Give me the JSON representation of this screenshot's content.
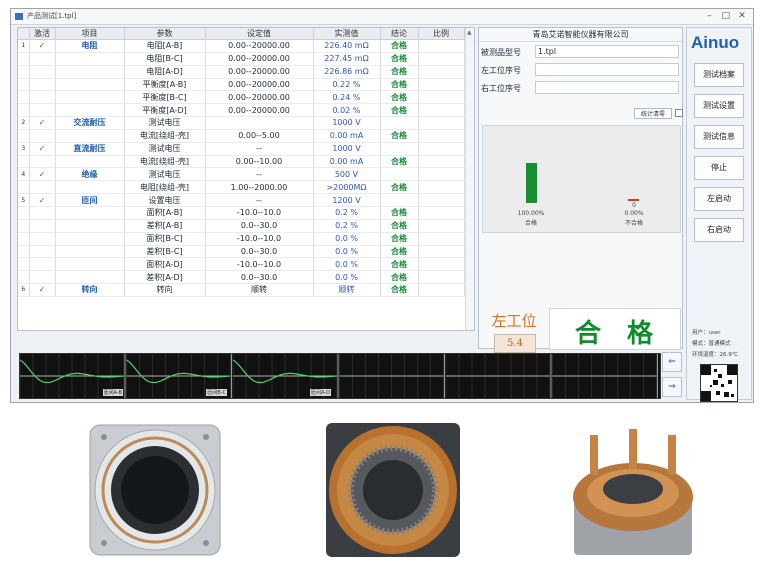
{
  "window": {
    "title": "产品测试[1.tpl]",
    "controls": [
      "–",
      "□",
      "✕"
    ]
  },
  "table": {
    "headers": [
      "",
      "激活",
      "项目",
      "参数",
      "设定值",
      "实测值",
      "结论",
      "比例"
    ],
    "rows": [
      {
        "idx": "1",
        "chk": "✓",
        "item": "电阻",
        "param": "电阻[A-B]",
        "set": "0.00--20000.00",
        "meas": "226.40 mΩ",
        "res": "合格"
      },
      {
        "idx": "",
        "chk": "",
        "item": "",
        "param": "电阻[B-C]",
        "set": "0.00--20000.00",
        "meas": "227.45 mΩ",
        "res": "合格"
      },
      {
        "idx": "",
        "chk": "",
        "item": "",
        "param": "电阻[A-D]",
        "set": "0.00--20000.00",
        "meas": "226.86 mΩ",
        "res": "合格"
      },
      {
        "idx": "",
        "chk": "",
        "item": "",
        "param": "平衡度[A-B]",
        "set": "0.00--20000.00",
        "meas": "0.22 %",
        "res": "合格"
      },
      {
        "idx": "",
        "chk": "",
        "item": "",
        "param": "平衡度[B-C]",
        "set": "0.00--20000.00",
        "meas": "0.24 %",
        "res": "合格"
      },
      {
        "idx": "",
        "chk": "",
        "item": "",
        "param": "平衡度[A-D]",
        "set": "0.00--20000.00",
        "meas": "0.02 %",
        "res": "合格"
      },
      {
        "idx": "2",
        "chk": "✓",
        "item": "交流耐压",
        "param": "测试电压",
        "set": "",
        "meas": "1000 V",
        "res": ""
      },
      {
        "idx": "",
        "chk": "",
        "item": "",
        "param": "电流[绕组-壳]",
        "set": "0.00--5.00",
        "meas": "0.00 mA",
        "res": "合格"
      },
      {
        "idx": "3",
        "chk": "✓",
        "item": "直流耐压",
        "param": "测试电压",
        "set": "--",
        "meas": "1000 V",
        "res": ""
      },
      {
        "idx": "",
        "chk": "",
        "item": "",
        "param": "电流[绕组-壳]",
        "set": "0.00--10.00",
        "meas": "0.00 mA",
        "res": "合格"
      },
      {
        "idx": "4",
        "chk": "✓",
        "item": "绝缘",
        "param": "测试电压",
        "set": "--",
        "meas": "500 V",
        "res": ""
      },
      {
        "idx": "",
        "chk": "",
        "item": "",
        "param": "电阻[绕组-壳]",
        "set": "1.00--2000.00",
        "meas": ">2000MΩ",
        "res": "合格"
      },
      {
        "idx": "5",
        "chk": "✓",
        "item": "匝间",
        "param": "设置电压",
        "set": "--",
        "meas": "1200 V",
        "res": ""
      },
      {
        "idx": "",
        "chk": "",
        "item": "",
        "param": "面积[A-B]",
        "set": "-10.0--10.0",
        "meas": "0.2 %",
        "res": "合格"
      },
      {
        "idx": "",
        "chk": "",
        "item": "",
        "param": "差积[A-B]",
        "set": "0.0--30.0",
        "meas": "0.2 %",
        "res": "合格"
      },
      {
        "idx": "",
        "chk": "",
        "item": "",
        "param": "面积[B-C]",
        "set": "-10.0--10.0",
        "meas": "0.0 %",
        "res": "合格"
      },
      {
        "idx": "",
        "chk": "",
        "item": "",
        "param": "差积[B-C]",
        "set": "0.0--30.0",
        "meas": "0.0 %",
        "res": "合格"
      },
      {
        "idx": "",
        "chk": "",
        "item": "",
        "param": "面积[A-D]",
        "set": "-10.0--10.0",
        "meas": "0.0 %",
        "res": "合格"
      },
      {
        "idx": "",
        "chk": "",
        "item": "",
        "param": "差积[A-D]",
        "set": "0.0--30.0",
        "meas": "0.0 %",
        "res": "合格"
      },
      {
        "idx": "6",
        "chk": "✓",
        "item": "转向",
        "param": "转向",
        "set": "顺转",
        "meas": "顺转",
        "res": "合格"
      }
    ]
  },
  "info": {
    "company": "青岛艾诺智能仪器有限公司",
    "model_label": "被测品型号",
    "model_value": "1.tpl",
    "left_serial_label": "左工位序号",
    "left_serial_value": "",
    "right_serial_label": "右工位序号",
    "right_serial_value": "",
    "stat_button": "统计清零",
    "pass_pct": "100.00%",
    "pass_label": "合格",
    "fail_pct": "0.00%",
    "fail_label": "不合格",
    "fail_count": "0",
    "pass_rate": 1.0,
    "station_label": "左工位",
    "station_time": "5.4",
    "big_result": "合格"
  },
  "sidebar": {
    "logo": "Ainuo",
    "buttons": [
      "测试档案",
      "测试设置",
      "测试信息",
      "停止",
      "左启动",
      "右启动"
    ],
    "user": "用户：user",
    "type": "模式：普通模式",
    "temp": "环境温度：26.9℃"
  },
  "waves": {
    "labels": [
      "匝间A-B",
      "匝间B-C",
      "匝间A-D"
    ]
  },
  "nav": {
    "prev": "⇐",
    "next": "⇒"
  },
  "colors": {
    "pass_green": "#0e8d2c",
    "accent_blue": "#1d62b0",
    "orange": "#e0701b"
  }
}
